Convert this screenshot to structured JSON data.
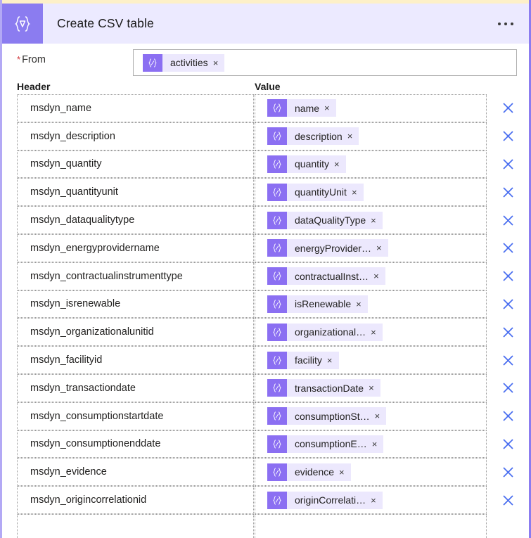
{
  "window": {
    "accent_purple": "#8b7cf0",
    "header_bg": "#eceaff",
    "top_strip_color": "#fdf0c8"
  },
  "header": {
    "title": "Create CSV table",
    "icon": "csv-table-braces-icon",
    "menu_icon": "more-options-icon"
  },
  "from_field": {
    "required_marker": "*",
    "label": "From",
    "token": {
      "icon": "dynamic-content-icon",
      "text": "activities",
      "remove_label": "×"
    }
  },
  "columns": {
    "header_label": "Header",
    "value_label": "Value"
  },
  "delete_icon": {
    "name": "delete-row-icon",
    "color": "#4a6ef0"
  },
  "rows": [
    {
      "header": "msdyn_name",
      "value": "name",
      "remove_label": "×"
    },
    {
      "header": "msdyn_description",
      "value": "description",
      "remove_label": "×"
    },
    {
      "header": "msdyn_quantity",
      "value": "quantity",
      "remove_label": "×"
    },
    {
      "header": "msdyn_quantityunit",
      "value": "quantityUnit",
      "remove_label": "×"
    },
    {
      "header": "msdyn_dataqualitytype",
      "value": "dataQualityType",
      "remove_label": "×"
    },
    {
      "header": "msdyn_energyprovidername",
      "value": "energyProvider…",
      "remove_label": "×"
    },
    {
      "header": "msdyn_contractualinstrumenttype",
      "value": "contractualInst…",
      "remove_label": "×"
    },
    {
      "header": "msdyn_isrenewable",
      "value": "isRenewable",
      "remove_label": "×"
    },
    {
      "header": "msdyn_organizationalunitid",
      "value": "organizational…",
      "remove_label": "×"
    },
    {
      "header": "msdyn_facilityid",
      "value": "facility",
      "remove_label": "×"
    },
    {
      "header": "msdyn_transactiondate",
      "value": "transactionDate",
      "remove_label": "×"
    },
    {
      "header": "msdyn_consumptionstartdate",
      "value": "consumptionSt…",
      "remove_label": "×"
    },
    {
      "header": "msdyn_consumptionenddate",
      "value": "consumptionE…",
      "remove_label": "×"
    },
    {
      "header": "msdyn_evidence",
      "value": "evidence",
      "remove_label": "×"
    },
    {
      "header": "msdyn_origincorrelationid",
      "value": "originCorrelati…",
      "remove_label": "×"
    },
    {
      "header": "",
      "value": null,
      "remove_label": ""
    }
  ]
}
